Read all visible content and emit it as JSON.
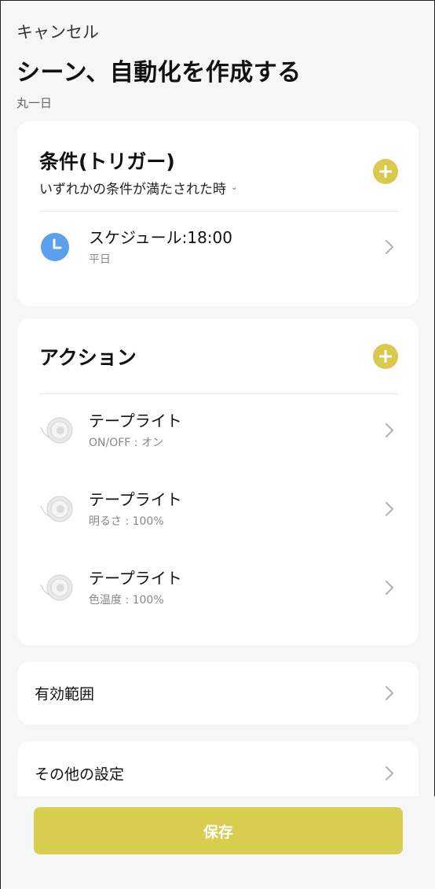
{
  "header": {
    "cancel_label": "キャンセル",
    "title": "シーン、自動化を作成する",
    "subtitle": "丸一日"
  },
  "conditions": {
    "title": "条件(トリガー)",
    "mode_label": "いずれかの条件が満たされた時",
    "items": [
      {
        "title": "スケジュール:18:00",
        "sub": "平日",
        "icon": "clock-icon"
      }
    ]
  },
  "actions": {
    "title": "アクション",
    "items": [
      {
        "title": "テープライト",
        "sub": "ON/OFF : オン",
        "icon": "tape-light-icon"
      },
      {
        "title": "テープライト",
        "sub": "明るさ : 100%",
        "icon": "tape-light-icon"
      },
      {
        "title": "テープライト",
        "sub": "色温度 : 100%",
        "icon": "tape-light-icon"
      }
    ]
  },
  "scope": {
    "label": "有効範囲"
  },
  "other_settings": {
    "label": "その他の設定"
  },
  "footer": {
    "save_label": "保存"
  },
  "colors": {
    "accent": "#d9c94e",
    "clock": "#5aa0ea",
    "background": "#f6f6f6"
  }
}
